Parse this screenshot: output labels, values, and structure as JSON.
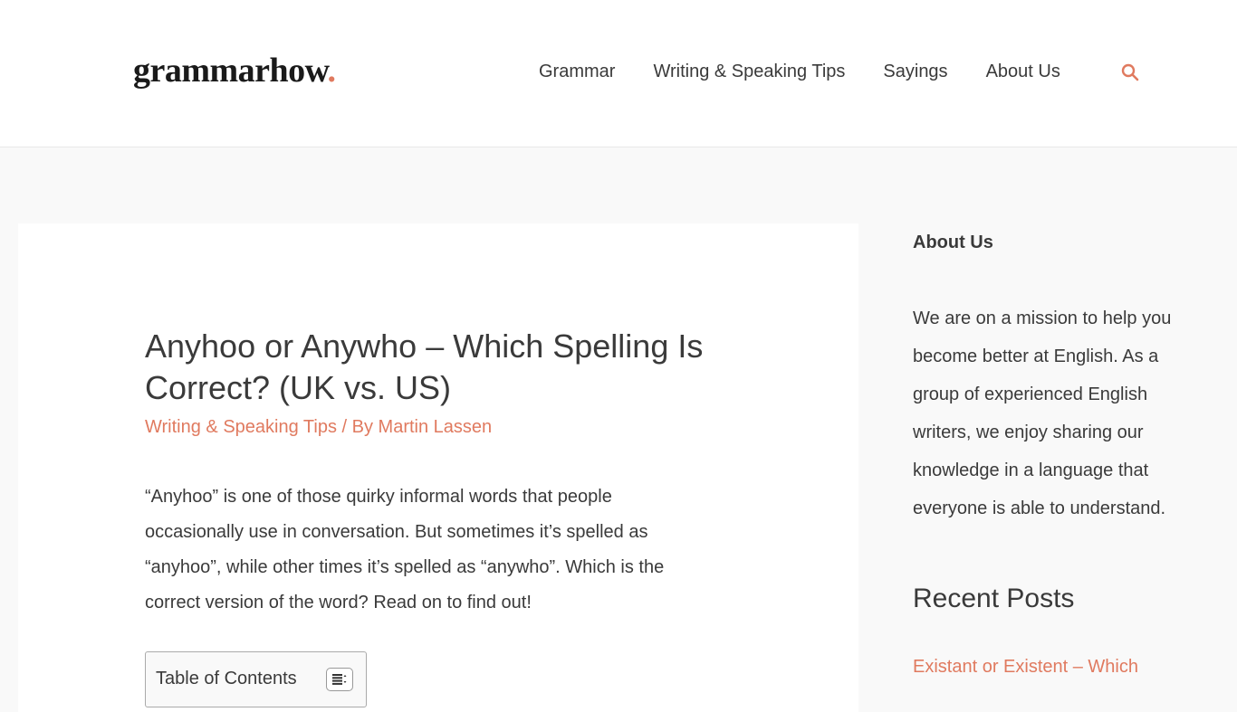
{
  "header": {
    "logo_text": "grammarhow",
    "logo_dot": ".",
    "nav": [
      {
        "label": "Grammar"
      },
      {
        "label": "Writing & Speaking Tips"
      },
      {
        "label": "Sayings"
      },
      {
        "label": "About Us"
      }
    ],
    "search_icon": "search-icon",
    "accent_color": "#e07a5f"
  },
  "article": {
    "title": "Anyhoo or Anywho – Which Spelling Is Correct? (UK vs. US)",
    "category": "Writing & Speaking Tips",
    "separator": " / By ",
    "author": "Martin Lassen",
    "intro": "“Anyhoo” is one of those quirky informal words that people occasionally use in conversation. But sometimes it’s spelled as “anyhoo”, while other times it’s spelled as “anywho”. Which is the correct version of the word? Read on to find out!",
    "toc": {
      "title": "Table of Contents",
      "toggle_icon": "list-toggle-icon"
    }
  },
  "sidebar": {
    "about_title": "About Us",
    "about_text": "We are on a mission to help you become better at English. As a group of experienced English writers, we enjoy sharing our knowledge in a language that everyone is able to understand.",
    "recent_title": "Recent Posts",
    "recent_posts": [
      {
        "label": "Existant or Existent – Which"
      }
    ]
  }
}
